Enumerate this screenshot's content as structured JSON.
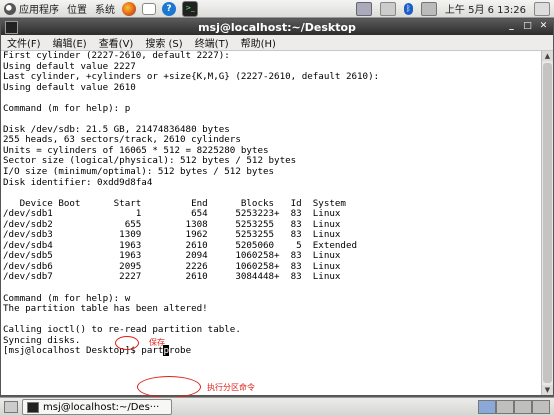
{
  "top_panel": {
    "apps_menu": "应用程序",
    "places_menu": "位置",
    "system_menu": "系统",
    "clock": "上午 5月  6 13:26"
  },
  "window": {
    "title": "msj@localhost:~/Desktop",
    "menus": [
      "文件(F)",
      "编辑(E)",
      "查看(V)",
      "搜索 (S)",
      "终端(T)",
      "帮助(H)"
    ]
  },
  "terminal": {
    "lines": [
      "First cylinder (2227-2610, default 2227):",
      "Using default value 2227",
      "Last cylinder, +cylinders or +size{K,M,G} (2227-2610, default 2610):",
      "Using default value 2610",
      "",
      "Command (m for help): p",
      "",
      "Disk /dev/sdb: 21.5 GB, 21474836480 bytes",
      "255 heads, 63 sectors/track, 2610 cylinders",
      "Units = cylinders of 16065 * 512 = 8225280 bytes",
      "Sector size (logical/physical): 512 bytes / 512 bytes",
      "I/O size (minimum/optimal): 512 bytes / 512 bytes",
      "Disk identifier: 0xdd9d8fa4",
      "",
      "   Device Boot      Start         End      Blocks   Id  System",
      "/dev/sdb1               1         654     5253223+  83  Linux",
      "/dev/sdb2             655        1308     5253255   83  Linux",
      "/dev/sdb3            1309        1962     5253255   83  Linux",
      "/dev/sdb4            1963        2610     5205060    5  Extended",
      "/dev/sdb5            1963        2094     1060258+  83  Linux",
      "/dev/sdb6            2095        2226     1060258+  83  Linux",
      "/dev/sdb7            2227        2610     3084448+  83  Linux",
      "",
      "Command (m for help): w",
      "The partition table has been altered!",
      "",
      "Calling ioctl() to re-read partition table.",
      "Syncing disks.",
      "[msj@localhost Desktop]$ "
    ],
    "command_before_cursor": "part",
    "cursor_char": "p",
    "command_after_cursor": "robe"
  },
  "annotations": {
    "save_note": "保存",
    "partprobe_note": "执行分区命令",
    "color": "#e0201a"
  },
  "taskbar": {
    "task_label": "msj@localhost:~/Des···"
  }
}
